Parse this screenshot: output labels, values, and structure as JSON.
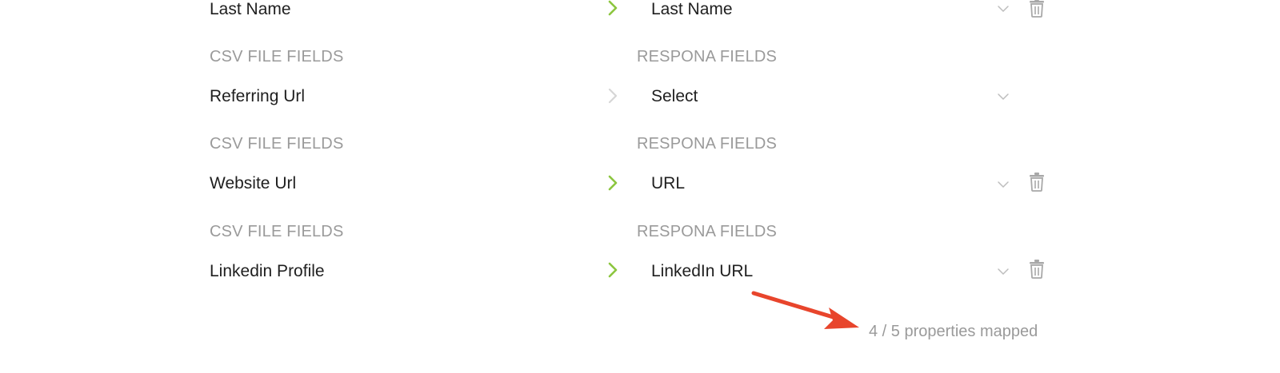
{
  "mapping_rows": [
    {
      "csv_label": "",
      "respona_label": "",
      "csv_field": "Last Name",
      "respona_field": "Last Name",
      "mapped": true,
      "deletable": true
    },
    {
      "csv_label": "CSV FILE FIELDS",
      "respona_label": "RESPONA FIELDS",
      "csv_field": "Referring Url",
      "respona_field": "Select",
      "mapped": false,
      "deletable": false
    },
    {
      "csv_label": "CSV FILE FIELDS",
      "respona_label": "RESPONA FIELDS",
      "csv_field": "Website Url",
      "respona_field": "URL",
      "mapped": true,
      "deletable": true
    },
    {
      "csv_label": "CSV FILE FIELDS",
      "respona_label": "RESPONA FIELDS",
      "csv_field": "Linkedin Profile",
      "respona_field": "LinkedIn URL",
      "mapped": true,
      "deletable": true
    }
  ],
  "footer": {
    "mapped_summary": "4 / 5 properties mapped"
  },
  "colors": {
    "mapped_arrow": "#8cc63f",
    "unmapped_arrow": "#d6d6d6",
    "label_gray": "#9a9a9a",
    "annotation_red": "#e8452c"
  },
  "icons": {
    "mapped_indicator": "chevron-right-icon",
    "dropdown": "chevron-down-icon",
    "delete": "trash-icon",
    "annotation": "arrow-icon"
  }
}
